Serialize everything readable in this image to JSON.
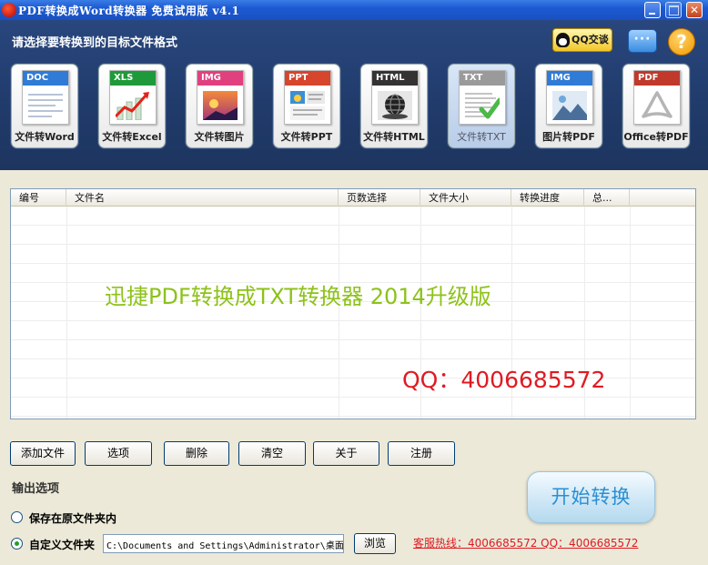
{
  "window": {
    "title": "PDF转换成Word转换器 免费试用版 v4.1"
  },
  "header": {
    "prompt": "请选择要转换到的目标文件格式",
    "qq_label": "QQ交谈",
    "chat_glyph": "···",
    "help_glyph": "?"
  },
  "tiles": [
    {
      "band": "DOC",
      "label": "文件转Word",
      "color": "#2f7bd6"
    },
    {
      "band": "XLS",
      "label": "文件转Excel",
      "color": "#1f9a3a"
    },
    {
      "band": "IMG",
      "label": "文件转图片",
      "color": "#e0417e"
    },
    {
      "band": "PPT",
      "label": "文件转PPT",
      "color": "#d6452c"
    },
    {
      "band": "HTML",
      "label": "文件转HTML",
      "color": "#333333"
    },
    {
      "band": "TXT",
      "label": "文件转TXT",
      "color": "#9a9a9a"
    },
    {
      "band": "IMG",
      "label": "图片转PDF",
      "color": "#2f7bd6"
    },
    {
      "band": "PDF",
      "label": "Office转PDF",
      "color": "#c0392b"
    }
  ],
  "table": {
    "columns": [
      "编号",
      "文件名",
      "页数选择",
      "文件大小",
      "转换进度",
      "总..."
    ]
  },
  "promo": {
    "headline": "迅捷PDF转换成TXT转换器  2014升级版",
    "qq": "QQ：4006685572"
  },
  "buttons": {
    "add_file": "添加文件",
    "options": "选项",
    "delete": "删除",
    "clear": "清空",
    "about": "关于",
    "register": "注册",
    "browse": "浏览",
    "start": "开始转换"
  },
  "output": {
    "section_label": "输出选项",
    "keep_original": "保存在原文件夹内",
    "custom_folder": "自定义文件夹",
    "path": "C:\\Documents and Settings\\Administrator\\桌面"
  },
  "support": {
    "hotline": "客服热线：4006685572 QQ：4006685572"
  }
}
